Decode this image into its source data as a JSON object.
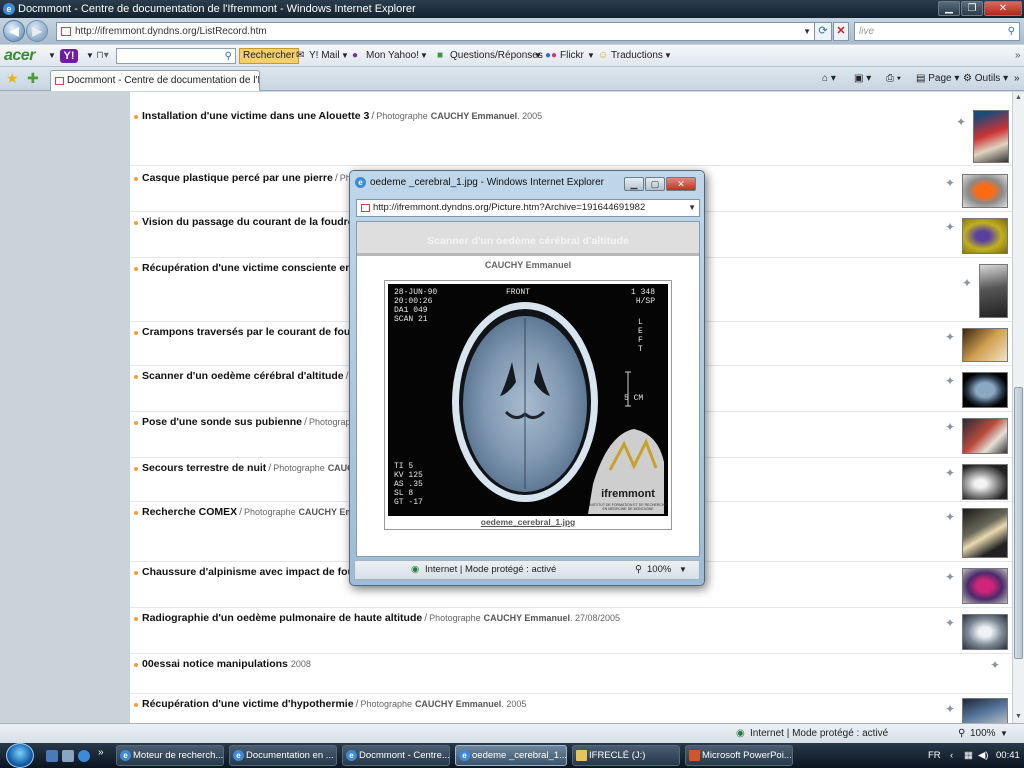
{
  "browser": {
    "title": "Docmmont - Centre de documentation de l'Ifremmont - Windows Internet Explorer",
    "url": "http://ifremmont.dyndns.org/ListRecord.htm",
    "search_placeholder": "live"
  },
  "toolbar": {
    "brand": "acer",
    "rechercher": "Rechercher",
    "ymail": "Y! Mail",
    "mon_yahoo": "Mon Yahoo!",
    "questions": "Questions/Réponses",
    "flickr": "Flickr",
    "traductions": "Traductions"
  },
  "tab": {
    "label": "Docmmont - Centre de documentation de l'Ifre...",
    "page_menu": "Page",
    "tools_menu": "Outils"
  },
  "records": [
    {
      "title": "Installation d'une victime dans une Alouette 3",
      "role": "Photographe",
      "author": "CAUCHY Emmanuel",
      "date": "2005"
    },
    {
      "title": "Casque plastique percé par une pierre",
      "role": "Phot",
      "author": "",
      "date": ""
    },
    {
      "title": "Vision du passage du courant de la foudre su",
      "role": "",
      "author": "",
      "date": ""
    },
    {
      "title": "Récupération d'une victime consciente en cr",
      "role": "",
      "author": "",
      "date": ""
    },
    {
      "title": "Crampons traversés par le courant de foudre",
      "role": "",
      "author": "",
      "date": ""
    },
    {
      "title": "Scanner d'un oedème cérébral d'altitude",
      "role": "P",
      "author": "",
      "date": ""
    },
    {
      "title": "Pose d'une sonde sus pubienne",
      "role": "Photographe",
      "author": "",
      "date": ""
    },
    {
      "title": "Secours terrestre de nuit",
      "role": "Photographe",
      "author": "CAUCH",
      "date": ""
    },
    {
      "title": "Recherche COMEX",
      "role": "Photographe",
      "author": "CAUCHY Emma",
      "date": ""
    },
    {
      "title": "Chaussure d'alpinisme avec impact de foudre",
      "role": "",
      "author": "",
      "date": ""
    },
    {
      "title": "Radiographie d'un oedème pulmonaire de haute altitude",
      "role": "Photographe",
      "author": "CAUCHY Emmanuel",
      "date": "27/08/2005"
    },
    {
      "title": "00essai notice manipulations",
      "role": "",
      "author": "",
      "date": "2008"
    },
    {
      "title": "Récupération d'une victime d'hypothermie",
      "role": "Photographe",
      "author": "CAUCHY Emmanuel",
      "date": "2005"
    }
  ],
  "status": {
    "zone": "Internet | Mode protégé : activé",
    "zoom": "100%"
  },
  "popup": {
    "title": "oedeme _cerebral_1.jpg - Windows Internet Explorer",
    "url": "http://ifremmont.dyndns.org/Picture.htm?Archive=191644691982",
    "header": "Scanner d'un oedème cérébral d'altitude",
    "author": "CAUCHY Emmanuel",
    "caption": "oedeme_cerebral_1.jpg",
    "status": "Internet | Mode protégé : activé",
    "zoom": "100%"
  },
  "scan": {
    "tl": [
      "28-JUN-90",
      "20:00:26",
      "DA1 049",
      "SCAN 21"
    ],
    "top": "FRONT",
    "tr": [
      "1 348",
      "H/SP"
    ],
    "side": [
      "L",
      "E",
      "F",
      "T"
    ],
    "scale": "5 CM",
    "bl": [
      "TI 5",
      "KV 125",
      "AS .35",
      "SL 8",
      "GT -17"
    ],
    "logo": "ifremmont",
    "logo_sub": [
      "INSTITUT DE FORMATION ET DE RECHERCHE",
      "EN MEDECINE DE MONTAGNE"
    ]
  },
  "taskbar": {
    "tasks": [
      "Moteur de recherch...",
      "Documentation en ...",
      "Docmmont - Centre...",
      "oedeme _cerebral_1....",
      "IFRECLÉ (J:)",
      "Microsoft PowerPoi..."
    ],
    "lang": "FR",
    "clock": "00:41"
  }
}
